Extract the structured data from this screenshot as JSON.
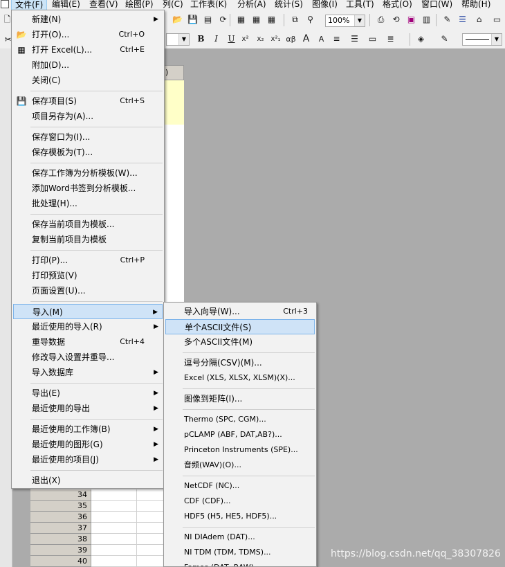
{
  "menubar": {
    "items": [
      "文件(F)",
      "编辑(E)",
      "查看(V)",
      "绘图(P)",
      "列(C)",
      "工作表(K)",
      "分析(A)",
      "统计(S)",
      "图像(I)",
      "工具(T)",
      "格式(O)",
      "窗口(W)",
      "帮助(H)"
    ]
  },
  "toolbar": {
    "zoom": "100%",
    "format_buttons": [
      "B",
      "I",
      "U",
      "x²",
      "x₂",
      "x²₁",
      "αβ",
      "A",
      "A"
    ]
  },
  "worksheet": {
    "col_header_fragment": ")",
    "row_numbers": [
      "34",
      "35",
      "36",
      "37",
      "38",
      "39",
      "40"
    ]
  },
  "file_menu": {
    "items": [
      {
        "label": "新建(N)",
        "shortcut": "",
        "submenu": true
      },
      {
        "label": "打开(O)...",
        "shortcut": "Ctrl+O"
      },
      {
        "label": "打开 Excel(L)...",
        "shortcut": "Ctrl+E"
      },
      {
        "label": "附加(D)...",
        "shortcut": ""
      },
      {
        "label": "关闭(C)",
        "shortcut": ""
      },
      {
        "label": "保存项目(S)",
        "shortcut": "Ctrl+S"
      },
      {
        "label": "项目另存为(A)...",
        "shortcut": ""
      },
      {
        "label": "保存窗口为(I)...",
        "shortcut": ""
      },
      {
        "label": "保存模板为(T)...",
        "shortcut": ""
      },
      {
        "label": "保存工作簿为分析模板(W)...",
        "shortcut": ""
      },
      {
        "label": "添加Word书签到分析模板...",
        "shortcut": ""
      },
      {
        "label": "批处理(H)...",
        "shortcut": ""
      },
      {
        "label": "保存当前项目为模板...",
        "shortcut": ""
      },
      {
        "label": "复制当前项目为模板",
        "shortcut": ""
      },
      {
        "label": "打印(P)...",
        "shortcut": "Ctrl+P"
      },
      {
        "label": "打印预览(V)",
        "shortcut": ""
      },
      {
        "label": "页面设置(U)...",
        "shortcut": ""
      },
      {
        "label": "导入(M)",
        "shortcut": "",
        "submenu": true
      },
      {
        "label": "最近使用的导入(R)",
        "shortcut": "",
        "submenu": true
      },
      {
        "label": "重导数据",
        "shortcut": "Ctrl+4"
      },
      {
        "label": "修改导入设置并重导...",
        "shortcut": ""
      },
      {
        "label": "导入数据库",
        "shortcut": "",
        "submenu": true
      },
      {
        "label": "导出(E)",
        "shortcut": "",
        "submenu": true
      },
      {
        "label": "最近使用的导出",
        "shortcut": "",
        "submenu": true
      },
      {
        "label": "最近使用的工作簿(B)",
        "shortcut": "",
        "submenu": true
      },
      {
        "label": "最近使用的图形(G)",
        "shortcut": "",
        "submenu": true
      },
      {
        "label": "最近使用的项目(J)",
        "shortcut": "",
        "submenu": true
      },
      {
        "label": "退出(X)",
        "shortcut": ""
      }
    ]
  },
  "import_submenu": {
    "items": [
      {
        "label": "导入向导(W)...",
        "shortcut": "Ctrl+3"
      },
      {
        "label": "单个ASCII文件(S)",
        "shortcut": ""
      },
      {
        "label": "多个ASCII文件(M)",
        "shortcut": ""
      },
      {
        "label": "逗号分隔(CSV)(M)...",
        "shortcut": ""
      },
      {
        "label": "Excel (XLS, XLSX, XLSM)(X)...",
        "shortcut": ""
      },
      {
        "label": "图像到矩阵(I)...",
        "shortcut": ""
      },
      {
        "label": "Thermo (SPC, CGM)...",
        "shortcut": ""
      },
      {
        "label": "pCLAMP (ABF, DAT,AB?)...",
        "shortcut": ""
      },
      {
        "label": "Princeton Instruments (SPE)...",
        "shortcut": ""
      },
      {
        "label": "音频(WAV)(O)...",
        "shortcut": ""
      },
      {
        "label": "NetCDF (NC)...",
        "shortcut": ""
      },
      {
        "label": "CDF (CDF)...",
        "shortcut": ""
      },
      {
        "label": "HDF5 (H5, HE5, HDF5)...",
        "shortcut": ""
      },
      {
        "label": "NI DIAdem (DAT)...",
        "shortcut": ""
      },
      {
        "label": "NI TDM (TDM, TDMS)...",
        "shortcut": ""
      },
      {
        "label": "Famos (DAT, RAW)...",
        "shortcut": ""
      }
    ]
  },
  "watermark": "https://blog.csdn.net/qq_38307826"
}
